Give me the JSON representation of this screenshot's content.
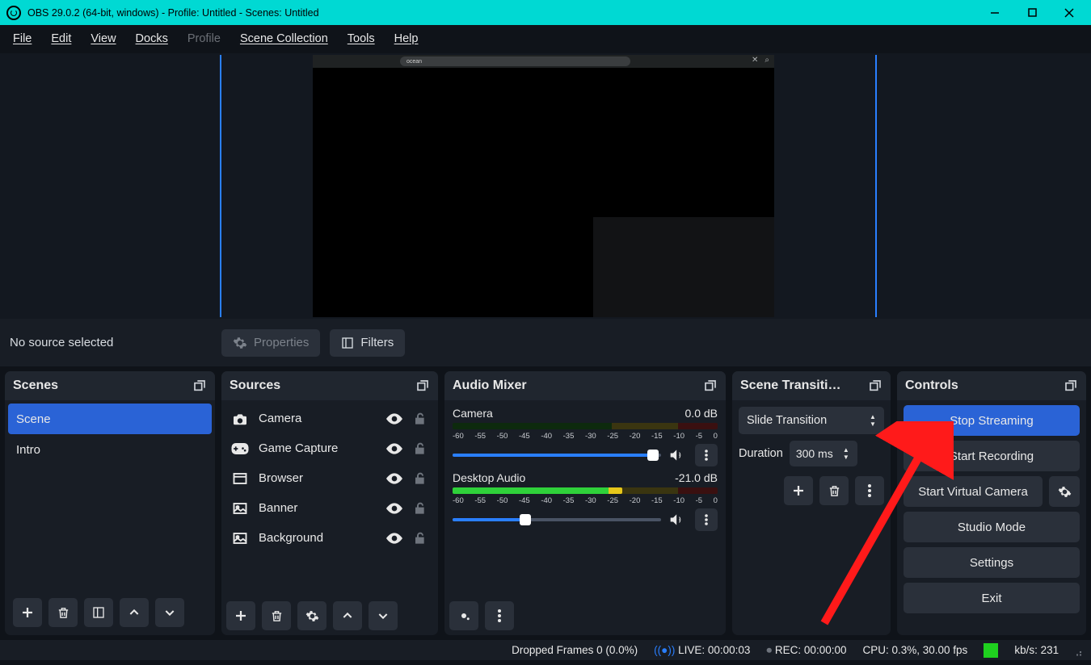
{
  "titlebar": {
    "title": "OBS 29.0.2 (64-bit, windows) - Profile: Untitled - Scenes: Untitled"
  },
  "menu": {
    "file": "File",
    "edit": "Edit",
    "view": "View",
    "docks": "Docks",
    "profile": "Profile",
    "scene_collection": "Scene Collection",
    "tools": "Tools",
    "help": "Help"
  },
  "preview": {
    "no_source": "No source selected",
    "properties": "Properties",
    "filters": "Filters",
    "search": "ocean"
  },
  "panels": {
    "scenes": {
      "title": "Scenes",
      "items": [
        "Scene",
        "Intro"
      ],
      "selected": 0
    },
    "sources": {
      "title": "Sources",
      "items": [
        {
          "icon": "camera",
          "label": "Camera"
        },
        {
          "icon": "gamepad",
          "label": "Game Capture"
        },
        {
          "icon": "window",
          "label": "Browser"
        },
        {
          "icon": "image",
          "label": "Banner"
        },
        {
          "icon": "image",
          "label": "Background"
        }
      ]
    },
    "audio": {
      "title": "Audio Mixer",
      "ticks": [
        "-60",
        "-55",
        "-50",
        "-45",
        "-40",
        "-35",
        "-30",
        "-25",
        "-20",
        "-15",
        "-10",
        "-5",
        "0"
      ],
      "channels": [
        {
          "name": "Camera",
          "db": "0.0 dB",
          "slider_pct": 96
        },
        {
          "name": "Desktop Audio",
          "db": "-21.0 dB",
          "slider_pct": 35
        }
      ]
    },
    "transitions": {
      "title": "Scene Transiti…",
      "selected": "Slide Transition",
      "duration_label": "Duration",
      "duration_value": "300 ms"
    },
    "controls": {
      "title": "Controls",
      "stop_streaming": "Stop Streaming",
      "start_recording": "Start Recording",
      "start_vc": "Start Virtual Camera",
      "studio": "Studio Mode",
      "settings": "Settings",
      "exit": "Exit"
    }
  },
  "status": {
    "dropped": "Dropped Frames 0 (0.0%)",
    "live": "LIVE: 00:00:03",
    "rec": "REC: 00:00:00",
    "cpu": "CPU: 0.3%, 30.00 fps",
    "kbs": "kb/s: 231"
  }
}
